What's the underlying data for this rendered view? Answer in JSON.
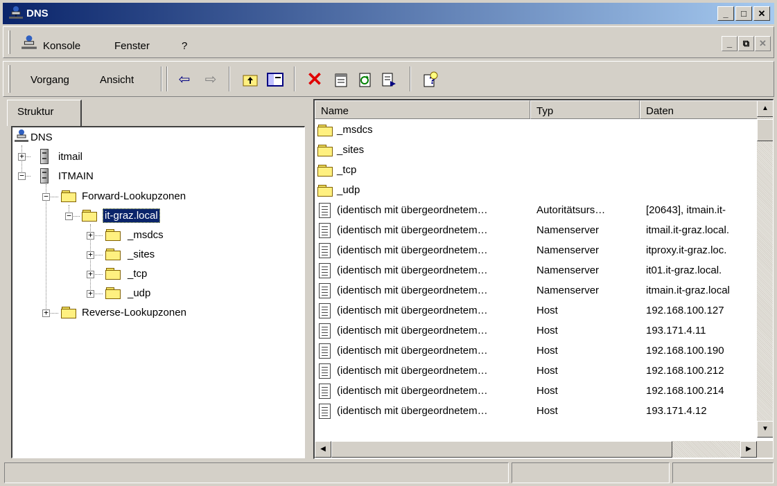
{
  "window": {
    "title": "DNS"
  },
  "menubar": {
    "items": [
      {
        "label": "Konsole"
      },
      {
        "label": "Fenster"
      },
      {
        "label": "?"
      }
    ]
  },
  "toolbar": {
    "vorgang": "Vorgang",
    "ansicht": "Ansicht",
    "icons": [
      "back-icon",
      "forward-icon",
      "up-folder-icon",
      "show-hide-tree-icon",
      "delete-icon",
      "properties-icon",
      "refresh-icon",
      "export-list-icon",
      "help-icon"
    ]
  },
  "tree": {
    "tab_label": "Struktur",
    "root": "DNS",
    "nodes": {
      "itmail": "itmail",
      "itmain": "ITMAIN",
      "forward": "Forward-Lookupzonen",
      "zone": "it-graz.local",
      "msdcs": "_msdcs",
      "sites": "_sites",
      "tcp": "_tcp",
      "udp": "_udp",
      "reverse": "Reverse-Lookupzonen"
    }
  },
  "list": {
    "columns": [
      "Name",
      "Typ",
      "Daten"
    ],
    "rows": [
      {
        "icon": "folder",
        "name": "_msdcs",
        "type": "",
        "data": ""
      },
      {
        "icon": "folder",
        "name": "_sites",
        "type": "",
        "data": ""
      },
      {
        "icon": "folder",
        "name": "_tcp",
        "type": "",
        "data": ""
      },
      {
        "icon": "folder",
        "name": "_udp",
        "type": "",
        "data": ""
      },
      {
        "icon": "record",
        "name": "(identisch mit übergeordnetem…",
        "type": "Autoritätsurs…",
        "data": "[20643], itmain.it-"
      },
      {
        "icon": "record",
        "name": "(identisch mit übergeordnetem…",
        "type": "Namenserver",
        "data": "itmail.it-graz.local."
      },
      {
        "icon": "record",
        "name": "(identisch mit übergeordnetem…",
        "type": "Namenserver",
        "data": "itproxy.it-graz.loc."
      },
      {
        "icon": "record",
        "name": "(identisch mit übergeordnetem…",
        "type": "Namenserver",
        "data": "it01.it-graz.local."
      },
      {
        "icon": "record",
        "name": "(identisch mit übergeordnetem…",
        "type": "Namenserver",
        "data": "itmain.it-graz.local"
      },
      {
        "icon": "record",
        "name": "(identisch mit übergeordnetem…",
        "type": "Host",
        "data": "192.168.100.127"
      },
      {
        "icon": "record",
        "name": "(identisch mit übergeordnetem…",
        "type": "Host",
        "data": "193.171.4.11"
      },
      {
        "icon": "record",
        "name": "(identisch mit übergeordnetem…",
        "type": "Host",
        "data": "192.168.100.190"
      },
      {
        "icon": "record",
        "name": "(identisch mit übergeordnetem…",
        "type": "Host",
        "data": "192.168.100.212"
      },
      {
        "icon": "record",
        "name": "(identisch mit übergeordnetem…",
        "type": "Host",
        "data": "192.168.100.214"
      },
      {
        "icon": "record",
        "name": "(identisch mit übergeordnetem…",
        "type": "Host",
        "data": "193.171.4.12"
      }
    ]
  },
  "colors": {
    "titlebar_start": "#0a246a",
    "titlebar_end": "#a6caf0",
    "selection": "#0a246a",
    "face": "#d4d0c8"
  }
}
